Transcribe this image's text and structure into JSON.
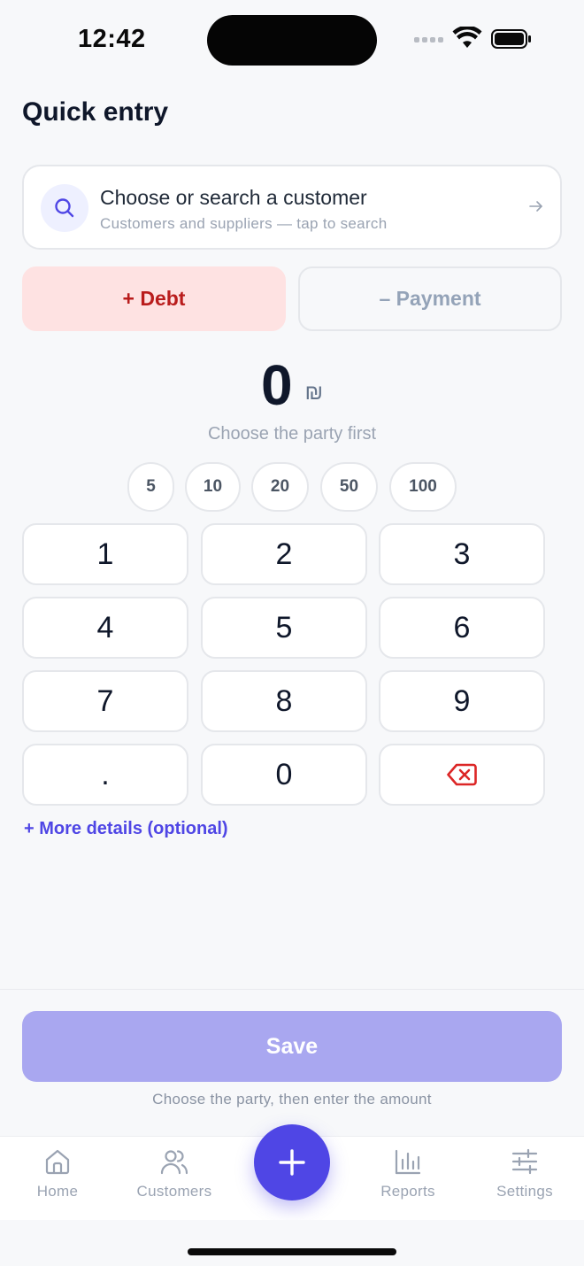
{
  "status_bar": {
    "time": "12:42"
  },
  "header": {
    "title": "Quick entry"
  },
  "customer_picker": {
    "title": "Choose or search a customer",
    "subtitle": "Customers and suppliers — tap to search",
    "icon": "search-icon",
    "arrow_icon": "arrow-right-icon"
  },
  "entry_type": {
    "debt_label": "+ Debt",
    "payment_label": "– Payment",
    "selected": "debt"
  },
  "amount": {
    "value": "0",
    "currency": "₪",
    "hint": "Choose the party first"
  },
  "quick_amounts": [
    "5",
    "10",
    "20",
    "50",
    "100"
  ],
  "keypad": {
    "keys": [
      "1",
      "2",
      "3",
      "4",
      "5",
      "6",
      "7",
      "8",
      "9",
      ".",
      "0"
    ],
    "backspace_icon": "backspace-icon"
  },
  "more_details_label": "+ More details (optional)",
  "save": {
    "label": "Save",
    "hint": "Choose the party, then enter the amount"
  },
  "bottom_nav": {
    "items": [
      {
        "label": "Home",
        "icon": "home-icon"
      },
      {
        "label": "Customers",
        "icon": "users-icon"
      },
      {
        "label": "Reports",
        "icon": "bar-chart-icon"
      },
      {
        "label": "Settings",
        "icon": "sliders-icon"
      }
    ],
    "fab_icon": "plus-icon"
  },
  "colors": {
    "accent": "#4f46e5",
    "debt_bg": "#fee2e2",
    "debt_text": "#b91c1c",
    "save_disabled": "#a9a7f0"
  }
}
